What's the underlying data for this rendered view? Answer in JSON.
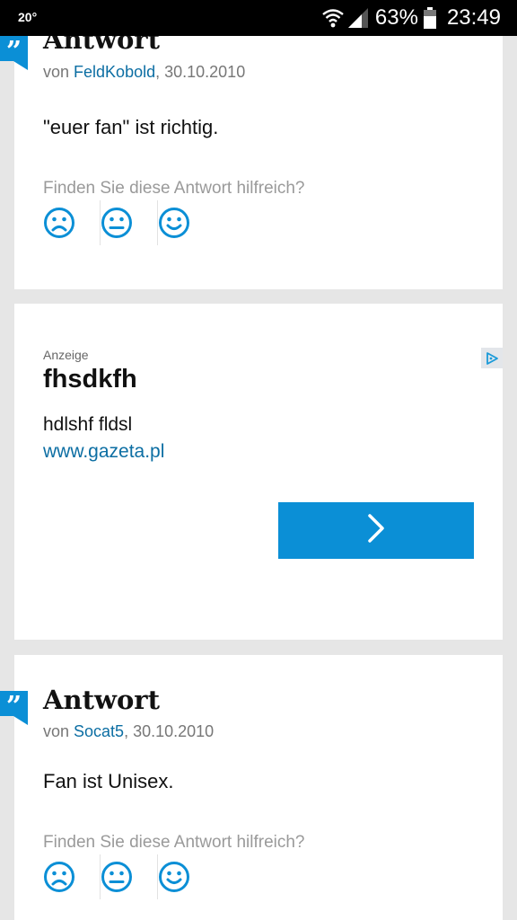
{
  "status_bar": {
    "temperature": "20°",
    "battery_percent": "63%",
    "time": "23:49"
  },
  "answers": [
    {
      "badge": "”",
      "title": "Antwort",
      "by_prefix": "von ",
      "author": "FeldKobold",
      "date": ", 30.10.2010",
      "text": "\"euer fan\" ist richtig.",
      "helpful_question": "Finden Sie diese Antwort hilfreich?"
    },
    {
      "badge": "”",
      "title": "Antwort",
      "by_prefix": "von ",
      "author": "Socat5",
      "date": ", 30.10.2010",
      "text": "Fan ist Unisex.",
      "helpful_question": "Finden Sie diese Antwort hilfreich?"
    }
  ],
  "rating_icons": [
    "sad-face-icon",
    "neutral-face-icon",
    "happy-face-icon"
  ],
  "ad": {
    "label": "Anzeige",
    "title": "fhsdkfh",
    "description": "hdlshf fldsl",
    "url": "www.gazeta.pl",
    "cta_icon": "chevron-right-icon",
    "choices_icon": "ad-choices-icon"
  },
  "colors": {
    "accent": "#0b8fd6",
    "link": "#0c6ea3",
    "page_bg": "#e6e6e6",
    "muted": "#9a9a9a"
  }
}
